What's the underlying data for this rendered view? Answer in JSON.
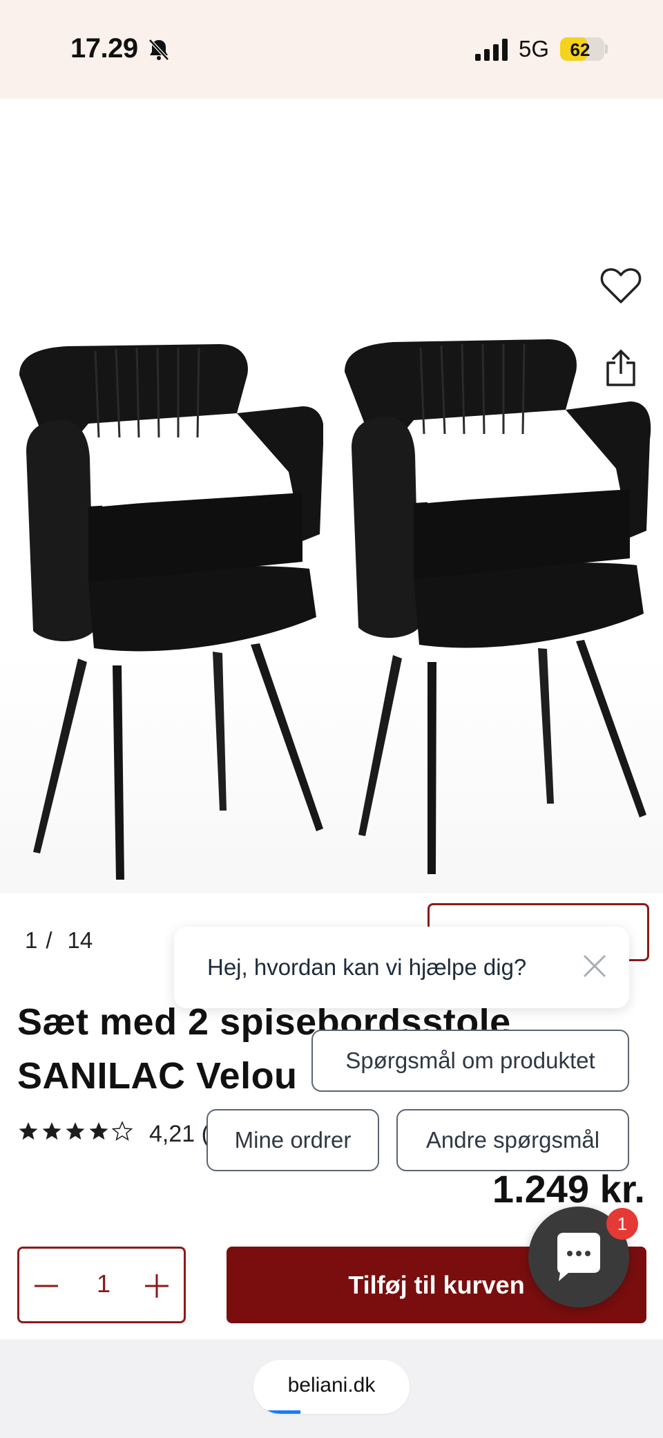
{
  "status_bar": {
    "time": "17.29",
    "network": "5G",
    "battery_level": "62",
    "battery_fraction": 0.62,
    "icons": [
      "bell-slash-icon",
      "signal-icon",
      "battery-icon"
    ]
  },
  "gallery": {
    "current": "1",
    "separator": "/",
    "total": "14",
    "actions": [
      "heart-icon",
      "share-icon"
    ]
  },
  "product": {
    "title_line1": "Sæt med 2 spisebordsstole",
    "title_line2": "SANILAC Velou",
    "rating_value": "4,21 (",
    "rating_stars": 4,
    "price": "1.249 kr."
  },
  "cart": {
    "quantity": "1",
    "add_label": "Tilføj til kurven"
  },
  "chat": {
    "greeting": "Hej, hvordan kan vi hjælpe dig?",
    "options": [
      "Spørgsmål om produktet",
      "Mine ordrer",
      "Andre spørgsmål"
    ],
    "badge_count": "1"
  },
  "browser": {
    "url": "beliani.dk",
    "load_progress": 0.3
  },
  "colors": {
    "brand": "#7a0e0e",
    "status_bg": "#fbf1ec",
    "badge": "#e53935",
    "progress": "#1a7cf5"
  }
}
